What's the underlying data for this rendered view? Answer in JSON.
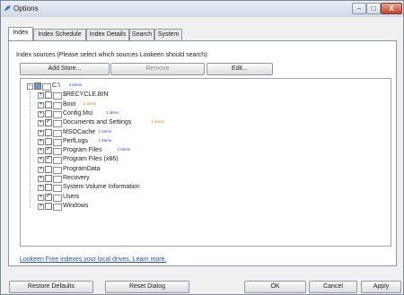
{
  "window": {
    "title": "Options",
    "minimize_glyph": "–",
    "maximize_glyph": "□",
    "close_glyph": "X"
  },
  "tabs": [
    "Index",
    "Index Schedule",
    "Index Details",
    "Search",
    "System"
  ],
  "sources_label": "Index sources (Please select which sources Lookeen should search):",
  "buttons": {
    "add": "Add Store...",
    "remove": "Remove",
    "edit": "Edit..."
  },
  "tree": [
    {
      "label": "C:\\",
      "count": "4 items",
      "count_color": "blue",
      "check": "partial",
      "expander": "−"
    },
    {
      "label": "$RECYCLE.BIN",
      "count": "",
      "check": "unchecked",
      "expander": "+"
    },
    {
      "label": "Boot",
      "count": "2 items",
      "count_color": "orange",
      "check": "unchecked",
      "expander": "+"
    },
    {
      "label": "Config.Msi",
      "count": "1 items",
      "count_color": "blue",
      "check": "unchecked",
      "expander": "+"
    },
    {
      "label": "Documents and Settings",
      "count": "1 items",
      "count_color": "orange",
      "check": "checked",
      "expander": "+"
    },
    {
      "label": "MSOCache",
      "count": "1 items",
      "count_color": "blue",
      "check": "unchecked",
      "expander": "+"
    },
    {
      "label": "PerfLogs",
      "count": "1 items",
      "count_color": "blue",
      "check": "unchecked",
      "expander": "+"
    },
    {
      "label": "Program Files",
      "count": "1 items",
      "count_color": "blue",
      "check": "checked",
      "expander": "+"
    },
    {
      "label": "Program Files (x86)",
      "count": "",
      "check": "checked",
      "expander": "+"
    },
    {
      "label": "ProgramData",
      "count": "",
      "check": "unchecked",
      "expander": "+"
    },
    {
      "label": "Recovery",
      "count": "",
      "check": "unchecked",
      "expander": "+"
    },
    {
      "label": "System Volume Information",
      "count": "",
      "check": "unchecked",
      "expander": "+"
    },
    {
      "label": "Users",
      "count": "",
      "check": "checked",
      "expander": "+"
    },
    {
      "label": "Windows",
      "count": "",
      "check": "unchecked",
      "expander": "+"
    }
  ],
  "link_text": "Lookeen Free indexes your local drives. Learn more.",
  "bottom_buttons": {
    "restore": "Restore Defaults",
    "reset": "Reset Dialog",
    "ok": "OK",
    "cancel": "Cancel",
    "apply": "Apply"
  }
}
